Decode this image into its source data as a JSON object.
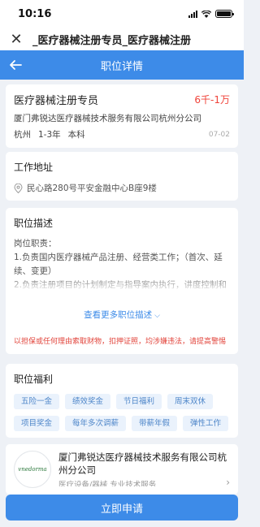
{
  "status_bar": {
    "time": "10:16"
  },
  "title_bar": {
    "close_icon": "close-icon",
    "title": "_医疗器械注册专员_医疗器械注册"
  },
  "nav": {
    "back_icon": "arrow-left-icon",
    "title": "职位详情"
  },
  "job": {
    "title": "医疗器械注册专员",
    "salary": "6千-1万",
    "company": "厦门弗锐达医疗器械技术服务有限公司杭州分公司",
    "city": "杭州",
    "experience": "1-3年",
    "education": "本科",
    "date": "07-02"
  },
  "address": {
    "section_title": "工作地址",
    "pin_icon": "location-pin-icon",
    "text": "民心路280号平安金融中心B座9楼"
  },
  "description": {
    "section_title": "职位描述",
    "line1": "岗位职责：",
    "line2": "1.负责国内医疗器械产品注册、经营类工作；（首次、延续、变更）",
    "line3": "2.负责注册项目的计划制定与指导案内执行，讲度控制和风",
    "more_label": "查看更多职位描述",
    "more_icon": "chevron-down-icon",
    "warning": "以担保或任何理由索取财物，扣押证照，均涉嫌违法，请提高警惕"
  },
  "welfare": {
    "section_title": "职位福利",
    "tags": [
      "五险一金",
      "绩效奖金",
      "节日福利",
      "周末双休",
      "项目奖金",
      "每年多次调薪",
      "带薪年假",
      "弹性工作"
    ]
  },
  "company": {
    "logo_text": "vnedorma",
    "name": "厦门弗锐达医疗器械技术服务有限公司杭州分公司",
    "desc": "医疗设备/器械 专业技术服务",
    "arrow_icon": "chevron-right-icon"
  },
  "apply_button": "立即申请",
  "colors": {
    "accent": "#3d8be8",
    "salary": "#f0433a",
    "warning": "#e2453c",
    "tag_bg": "#eaf2fc"
  }
}
